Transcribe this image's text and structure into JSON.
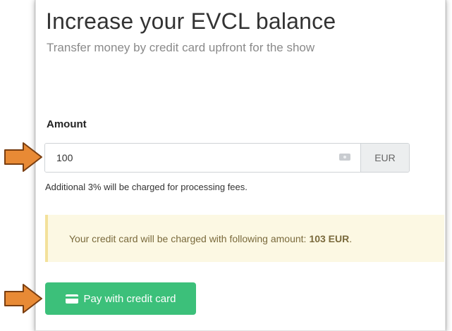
{
  "header": {
    "title": "Increase your EVCL balance",
    "subtitle": "Transfer money by credit card upfront for the show"
  },
  "form": {
    "amount_label": "Amount",
    "amount_value": "100",
    "currency": "EUR",
    "fee_note": "Additional 3% will be charged for processing fees."
  },
  "notice": {
    "text": "Your credit card will be charged with following amount:",
    "amount": "103 EUR",
    "suffix": "."
  },
  "actions": {
    "pay_label": "Pay with credit card"
  },
  "colors": {
    "button": "#3cc07a",
    "notice_bg": "#fcf8e3",
    "arrow": "#e88a35"
  },
  "icons": {
    "arrow": "arrow-right-icon",
    "card": "credit-card-icon",
    "autofill": "autofill-key-icon"
  }
}
